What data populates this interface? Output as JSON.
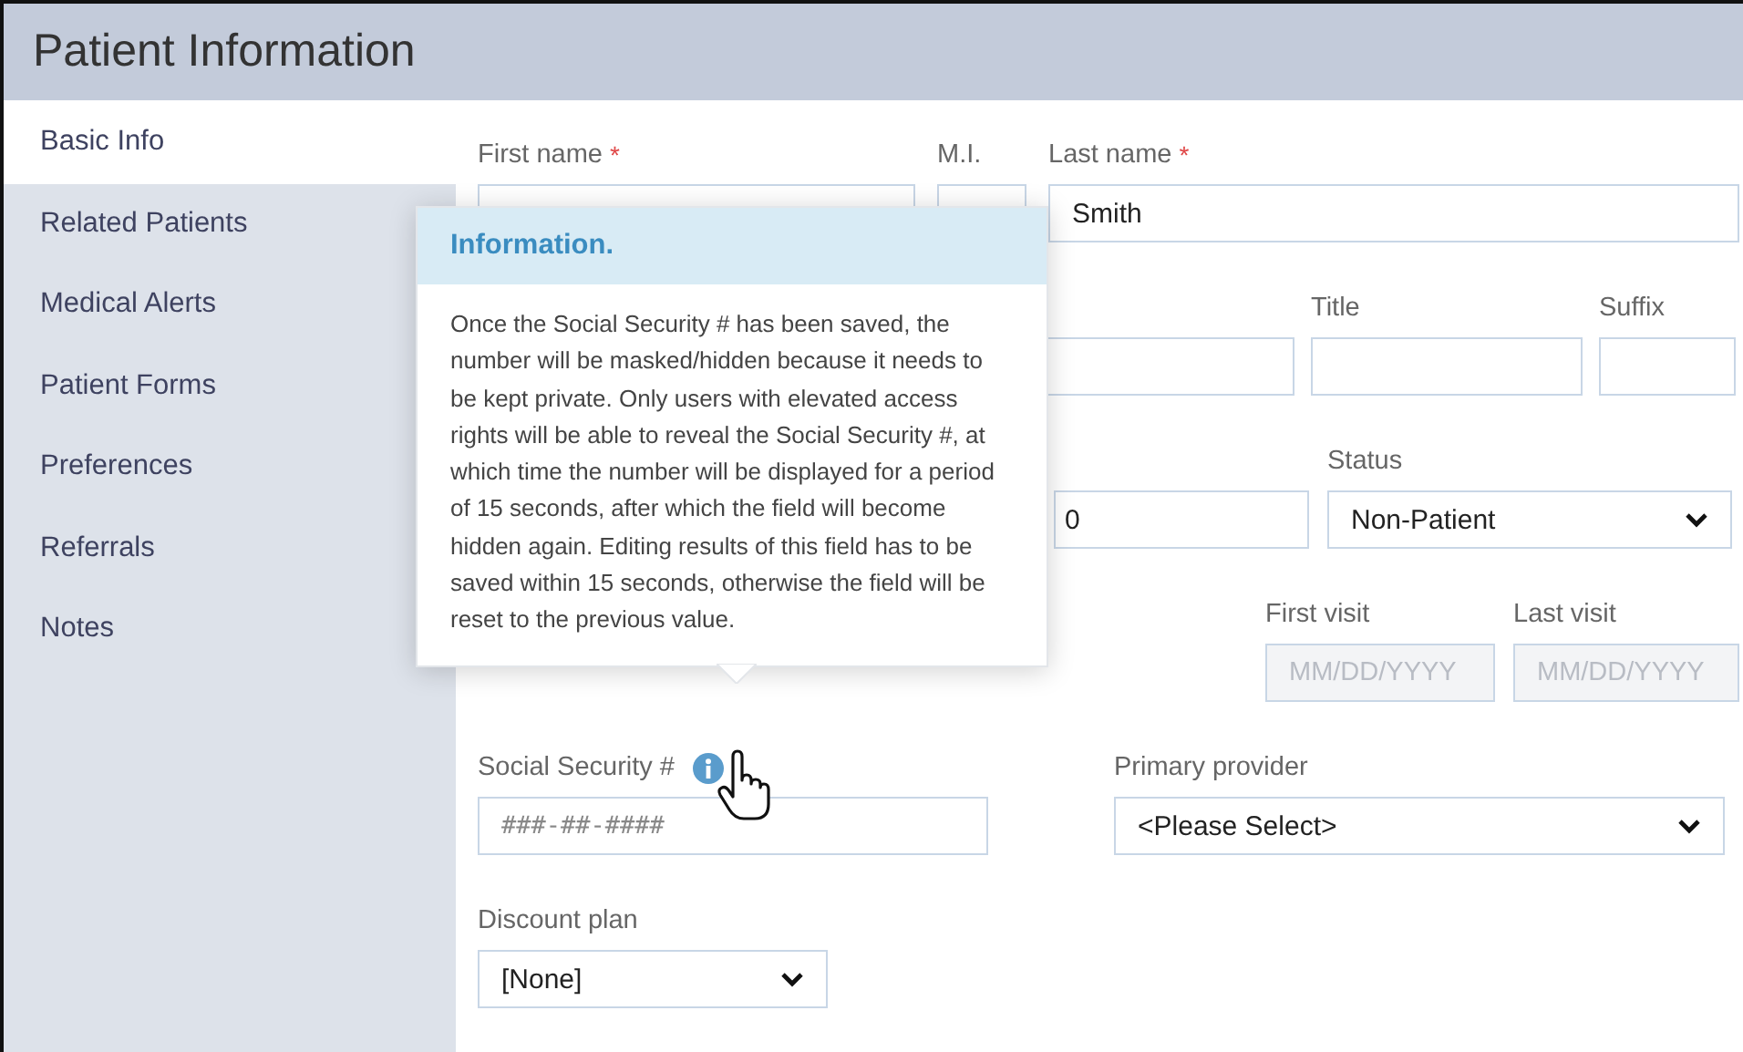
{
  "title": "Patient Information",
  "sidebar": {
    "items": [
      {
        "label": "Basic Info",
        "selected": true
      },
      {
        "label": "Related Patients",
        "selected": false
      },
      {
        "label": "Medical Alerts",
        "selected": false
      },
      {
        "label": "Patient Forms",
        "selected": false
      },
      {
        "label": "Preferences",
        "selected": false
      },
      {
        "label": "Referrals",
        "selected": false
      },
      {
        "label": "Notes",
        "selected": false
      }
    ]
  },
  "form": {
    "first_name": {
      "label": "First name",
      "required_mark": "*"
    },
    "middle_initial": {
      "label": "M.I."
    },
    "last_name": {
      "label": "Last name",
      "required_mark": "*",
      "value": "Smith"
    },
    "title_field": {
      "label": "Title"
    },
    "suffix": {
      "label": "Suffix"
    },
    "partly_hidden_field": {
      "value": "0"
    },
    "status": {
      "label": "Status",
      "value": "Non-Patient"
    },
    "first_visit": {
      "label": "First visit",
      "placeholder": "MM/DD/YYYY",
      "disabled": true
    },
    "last_visit": {
      "label": "Last visit",
      "placeholder": "MM/DD/YYYY",
      "disabled": true
    },
    "ssn": {
      "label": "Social Security #",
      "placeholder": "###-##-####"
    },
    "primary_provider": {
      "label": "Primary provider",
      "value": "<Please Select>"
    },
    "discount_plan": {
      "label": "Discount plan",
      "value": "[None]"
    }
  },
  "tooltip": {
    "title": "Information.",
    "text": "Once the Social Security # has been saved, the number will be masked/hidden because it needs to be kept private. Only users with elevated access rights will be able to reveal the Social Security #, at which time the number will be displayed for a period of 15 seconds, after which the field will become hidden again. Editing results of this field has to be saved within 15 seconds, otherwise the field will be reset  to the previous value."
  }
}
